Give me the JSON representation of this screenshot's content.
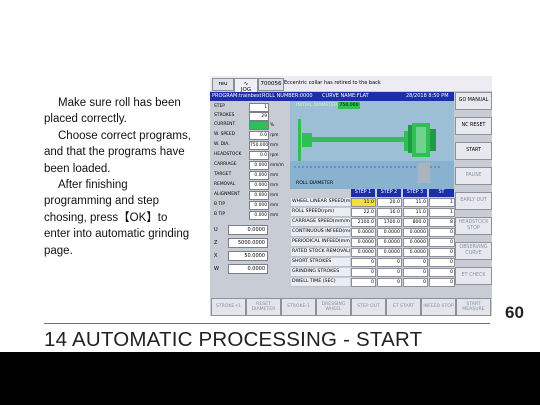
{
  "instructions": [
    "Make sure roll has been placed correctly.",
    "Choose correct programs, and that the programs have been loaded.",
    "After finishing programming and step chosing, press【OK】to enter into automatic grinding page."
  ],
  "slide_title": "14 AUTOMATIC PROCESSING - START",
  "page_number": "60",
  "hmi": {
    "header": {
      "mode": "reu",
      "channel_icon_label": "JOG",
      "code": "700056",
      "message": "Eccentric collar has retired to the back"
    },
    "program_bar": {
      "program": "PROGRAM:trainbest",
      "roll_number": "ROLL NUMBER:0000",
      "curve_name": "CURVE NAME:FLAT",
      "datetime": "28/2018 8:50 PM"
    },
    "left_params": [
      {
        "label": "STEP",
        "value": "1",
        "unit": ""
      },
      {
        "label": "STROKES",
        "value": "29",
        "unit": ""
      },
      {
        "label": "CURRENT",
        "value": "",
        "unit": "%"
      },
      {
        "label": "W. SPEED",
        "value": "0.0",
        "unit": "rpm"
      },
      {
        "label": "W. DIA.",
        "value": "750.000",
        "unit": "mm"
      },
      {
        "label": "HEADSTOCK",
        "value": "0.0",
        "unit": "rpm"
      },
      {
        "label": "CARRIAGE",
        "value": "0.000",
        "unit": "mm/m"
      },
      {
        "label": "TARGET",
        "value": "0.000",
        "unit": "mm"
      },
      {
        "label": "REMOVAL",
        "value": "0.000",
        "unit": "mm"
      },
      {
        "label": "ALIGNMENT",
        "value": "0.000",
        "unit": "mm"
      },
      {
        "label": "B TIP",
        "value": "0.000",
        "unit": "mm"
      },
      {
        "label": "B TIP",
        "value": "0.000",
        "unit": "mm"
      }
    ],
    "axes": [
      {
        "label": "U",
        "value": "0.0000"
      },
      {
        "label": "Z",
        "value": "5000.0000"
      },
      {
        "label": "X",
        "value": "50.0000"
      },
      {
        "label": "W",
        "value": "0.0000"
      }
    ],
    "viz": {
      "initial_diameter_label": "INITIAL DIAMETER",
      "initial_diameter_value": "750.000",
      "roll_diameter_label": "ROLL DIAMETER"
    },
    "grid": {
      "columns": [
        "STEP 1",
        "STEP 2",
        "STEP 3",
        "ST"
      ],
      "rows": [
        {
          "label": "WHEEL LINEAR SPEED(m/s)",
          "values": [
            "11.0",
            "20.0",
            "11.0",
            "1"
          ]
        },
        {
          "label": "ROLL SPEED(rpm)",
          "values": [
            "22.0",
            "16.0",
            "11.0",
            "1"
          ]
        },
        {
          "label": "CARRIAGE SPEED(mm/m)",
          "values": [
            "2100.0",
            "1700.0",
            "800.0",
            "8"
          ]
        },
        {
          "label": "CONTINUOUS INFEED(mm)",
          "values": [
            "0.0000",
            "0.0000",
            "0.0000",
            "0"
          ]
        },
        {
          "label": "PERIODICAL INFEED(mm)",
          "values": [
            "0.0000",
            "0.0000",
            "0.0000",
            "0"
          ]
        },
        {
          "label": "RATED STOCK REMOVAL(mm)",
          "values": [
            "0.0000",
            "0.0000",
            "0.0000",
            "0"
          ]
        },
        {
          "label": "SHORT STROKES",
          "values": [
            "0",
            "0",
            "0",
            "0"
          ]
        },
        {
          "label": "GRINDING STROKES",
          "values": [
            "0",
            "0",
            "0",
            "0"
          ]
        },
        {
          "label": "DWELL TIME (SEC)",
          "values": [
            "0",
            "0",
            "0",
            "0"
          ]
        }
      ]
    },
    "right_buttons": [
      "GO MANUAL",
      "NC RESET",
      "START",
      "PAUSE",
      "EARLY OUT",
      "HEADSTOCK STOP",
      "OBSERVING CURVE",
      "ET CHECK"
    ],
    "bottom_buttons": [
      "STROKE+1",
      "RESET DIAMETER",
      "STROKE-1",
      "DRESSING WHEEL",
      "STEP OUT",
      "ET START",
      "INFEED STOP",
      "START MEASURE"
    ]
  }
}
